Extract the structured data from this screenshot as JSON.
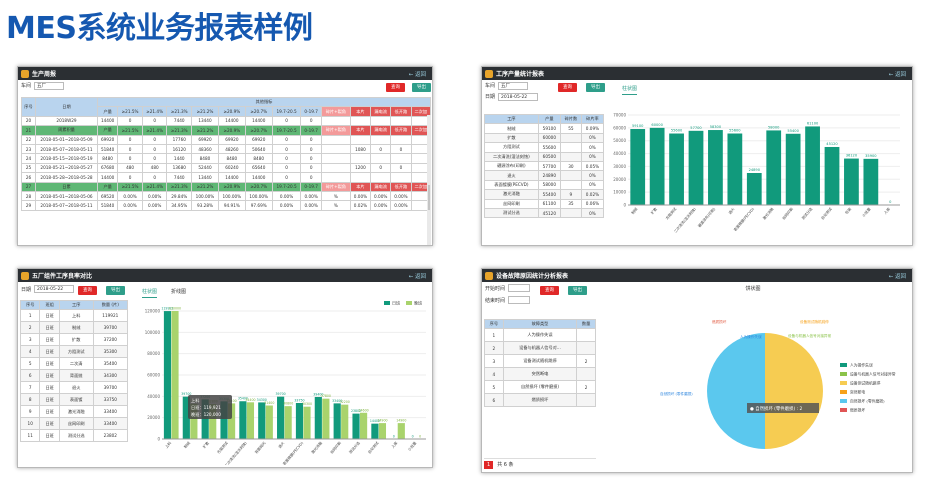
{
  "title": "MES系统业务报表样例",
  "colors": {
    "teal": "#119a7c",
    "lightgreen": "#a9d36c",
    "red": "#e02828",
    "header": "#2b2f33",
    "blue": "#b9d4ee",
    "greenrow": "#5fb775",
    "pink": "#f39a9a"
  },
  "common": {
    "back": "← 返回",
    "query": "查询",
    "export": "导出"
  },
  "p1": {
    "title": "生产周报",
    "workshop_label": "车间",
    "workshop_value": "五厂",
    "col_seq": "序号",
    "col_date": "日期",
    "group_label": "其他指标",
    "subcols": [
      "产量",
      "≥21.5%",
      "≥21.4%",
      "≥21.3%",
      "≥21.2%",
      "≥20.9%",
      "≥20.7%",
      "19.7-20.5",
      "0-19.7",
      "碎片+裂角",
      "本片",
      "漏电流",
      "低开路",
      "二次加"
    ],
    "rows": [
      {
        "seq": "20",
        "date": "2018W29",
        "c": [
          "14400",
          "0",
          "0",
          "7440",
          "13440",
          "14400",
          "14400",
          "0",
          "0",
          "",
          "",
          "",
          "",
          ""
        ],
        "style": "n"
      },
      {
        "seq": "21",
        "date": "周累积量",
        "c": [
          "产量",
          "≥21.5%",
          "≥21.4%",
          "≥21.3%",
          "≥21.2%",
          "≥20.9%",
          "≥20.7%",
          "19.7-20.5",
          "0-19.7",
          "碎片+裂角",
          "本片",
          "漏电流",
          "低开路",
          "二次加"
        ],
        "style": "g"
      },
      {
        "seq": "22",
        "date": "2018-05-01~2018-05-09",
        "c": [
          "69920",
          "0",
          "0",
          "17760",
          "69920",
          "69920",
          "69920",
          "0",
          "0",
          "",
          "",
          "",
          "",
          ""
        ],
        "style": "n"
      },
      {
        "seq": "23",
        "date": "2018-05-07~2018-05-11",
        "c": [
          "51840",
          "0",
          "0",
          "16120",
          "48360",
          "48260",
          "50640",
          "0",
          "0",
          "",
          "1080",
          "0",
          "0",
          ""
        ],
        "style": "n"
      },
      {
        "seq": "24",
        "date": "2018-05-15~2018-05-19",
        "c": [
          "8480",
          "0",
          "0",
          "1440",
          "8480",
          "8480",
          "8480",
          "0",
          "0",
          "",
          "",
          "",
          "",
          ""
        ],
        "style": "n"
      },
      {
        "seq": "25",
        "date": "2018-05-21~2018-05-27",
        "c": [
          "67680",
          "480",
          "480",
          "13680",
          "52440",
          "60240",
          "65640",
          "0",
          "0",
          "",
          "1200",
          "0",
          "0",
          ""
        ],
        "style": "n"
      },
      {
        "seq": "26",
        "date": "2018-05-28~2018-05-28",
        "c": [
          "14400",
          "0",
          "0",
          "7440",
          "13440",
          "14400",
          "14400",
          "0",
          "0",
          "",
          "",
          "",
          "",
          ""
        ],
        "style": "n"
      },
      {
        "seq": "27",
        "date": "日累",
        "c": [
          "产量",
          "≥21.5%",
          "≥21.4%",
          "≥21.3%",
          "≥21.2%",
          "≥20.9%",
          "≥20.7%",
          "19.7-20.5",
          "0-19.7",
          "碎片+裂角",
          "本片",
          "漏电流",
          "低开路",
          "二次加"
        ],
        "style": "g"
      },
      {
        "seq": "28",
        "date": "2018-05-01~2018-05-06",
        "c": [
          "69520",
          "0.00%",
          "0.00%",
          "29.84%",
          "100.00%",
          "100.00%",
          "100.00%",
          "0.00%",
          "0.00%",
          "%",
          "0.00%",
          "0.00%",
          "0.00%",
          ""
        ],
        "style": "n"
      },
      {
        "seq": "29",
        "date": "2018-05-07~2018-05-11",
        "c": [
          "51840",
          "0.00%",
          "0.00%",
          "34.95%",
          "93.28%",
          "94.91%",
          "97.69%",
          "0.00%",
          "0.00%",
          "%",
          "0.02%",
          "0.00%",
          "0.00%",
          ""
        ],
        "style": "n"
      }
    ]
  },
  "p2": {
    "title": "工序产量统计报表",
    "workshop_label": "车间",
    "workshop_value": "五厂",
    "date_label": "日期",
    "date_value": "2018-05-22",
    "tab": "柱状图",
    "headers": [
      "工序",
      "产量",
      "碎片数",
      "碎片率"
    ],
    "rows": [
      [
        "制绒",
        "59100",
        "55",
        "0.09%"
      ],
      [
        "扩散",
        "60000",
        "",
        "0%"
      ],
      [
        "方阻测试",
        "55600",
        "",
        "0%"
      ],
      [
        "二次清洗(湿法刻蚀)",
        "60500",
        "",
        "0%"
      ],
      [
        "硼源涂布(印刷)",
        "57700",
        "30",
        "0.05%"
      ],
      [
        "退火",
        "24890",
        "",
        "0%"
      ],
      [
        "表面镀膜(PECVD)",
        "58000",
        "",
        "0%"
      ],
      [
        "激光消融",
        "55400",
        "9",
        "0.02%"
      ],
      [
        "丝网印刷",
        "61100",
        "35",
        "0.06%"
      ],
      [
        "测试分选",
        "45120",
        "",
        "0%"
      ]
    ],
    "chart_data": {
      "type": "bar",
      "categories": [
        "制绒",
        "扩散",
        "方阻测试",
        "二次清洗(湿法刻蚀)",
        "硼源涂布(印刷)",
        "退火",
        "表面镀膜(PECVD)",
        "激光消融",
        "丝网印刷",
        "测试分选",
        "自动测试",
        "包装",
        "小批量",
        "入库"
      ],
      "values": [
        59100,
        60000,
        55600,
        57700,
        58300,
        55600,
        24890,
        58000,
        55400,
        61100,
        45120,
        36120,
        35900,
        0
      ],
      "ylim": [
        0,
        70000
      ],
      "yticks": [
        "70000",
        "60000",
        "50000",
        "40000",
        "30000",
        "20000",
        "10000",
        "0"
      ]
    }
  },
  "p3": {
    "title": "五厂组件工序良率对比",
    "date_label": "日期",
    "date_value": "2018-05-22",
    "tab1": "柱状图",
    "tab2": "折线图",
    "headers": [
      "序号",
      "班组",
      "工序",
      "数量 (片)"
    ],
    "rows": [
      [
        "1",
        "日班",
        "上料",
        "119921"
      ],
      [
        "2",
        "日班",
        "制绒",
        "39700"
      ],
      [
        "3",
        "日班",
        "扩散",
        "37200"
      ],
      [
        "4",
        "日班",
        "方阻测试",
        "35300"
      ],
      [
        "5",
        "日班",
        "二次清",
        "35400"
      ],
      [
        "6",
        "日班",
        "背面抛",
        "34300"
      ],
      [
        "7",
        "日班",
        "退火",
        "39700"
      ],
      [
        "8",
        "日班",
        "表面镀",
        "33750"
      ],
      [
        "9",
        "日班",
        "激光消融",
        "33400"
      ],
      [
        "10",
        "日班",
        "丝网印刷",
        "33400"
      ],
      [
        "11",
        "日班",
        "测试分选",
        "23802"
      ]
    ],
    "legend": [
      "日班",
      "晚班"
    ],
    "tooltip": {
      "title": "上料",
      "line1": "日班：119,921",
      "line2": "晚班：120,000"
    },
    "chart_data": {
      "type": "bar",
      "categories": [
        "上料",
        "制绒",
        "扩散",
        "方阻测试",
        "二次清洗(湿法刻蚀)",
        "背面抛光",
        "退火",
        "表面镀膜(PECVD)",
        "激光消融",
        "丝网印刷",
        "测试分选",
        "自动测试",
        "入库",
        "小批量"
      ],
      "series": [
        {
          "name": "日班",
          "values": [
            119921,
            39700,
            37200,
            35300,
            35400,
            34300,
            39700,
            33750,
            39400,
            33400,
            23802,
            14400,
            0,
            0
          ]
        },
        {
          "name": "晚班",
          "values": [
            120000,
            33100,
            32800,
            33400,
            34400,
            31400,
            30800,
            30300,
            37800,
            32200,
            24600,
            14900,
            14900,
            0
          ]
        }
      ],
      "ylim": [
        0,
        120000
      ],
      "yticks": [
        "120000",
        "100000",
        "80000",
        "60000",
        "40000",
        "20000",
        "0"
      ]
    }
  },
  "p4": {
    "title": "设备故障原因统计分析报表",
    "start_label": "开始时间",
    "end_label": "结束时间",
    "chart_title": "饼状图",
    "headers": [
      "序号",
      "故障类型",
      "数量"
    ],
    "rows": [
      [
        "1",
        "人为操作失误",
        ""
      ],
      [
        "2",
        "设备与机器人信号对...",
        ""
      ],
      [
        "3",
        "设备测试随机跳停",
        "2"
      ],
      [
        "4",
        "突然断电",
        ""
      ],
      [
        "5",
        "自然损坏 (零件磨损)",
        "2"
      ],
      [
        "6",
        "燃质损坏",
        ""
      ]
    ],
    "page": "1",
    "total": "共 6 条",
    "tooltip": "● 自然损坏 (零件磨损) : 2",
    "legend": [
      "人为操作失误",
      "设备与机器人信号对接异常",
      "设备测试随机跳停",
      "突然断电",
      "自然损坏 (零件磨损)",
      "燃质损坏"
    ],
    "pie_labels": [
      "燃质损坏",
      "人为操作失误",
      "设备与机器人信号对接异常",
      "设备测试随机跳停",
      "自然损坏 (零件磨损)"
    ],
    "chart_data": {
      "type": "pie",
      "labels": [
        "设备测试随机跳停",
        "自然损坏 (零件磨损)"
      ],
      "values": [
        2,
        2
      ]
    }
  }
}
